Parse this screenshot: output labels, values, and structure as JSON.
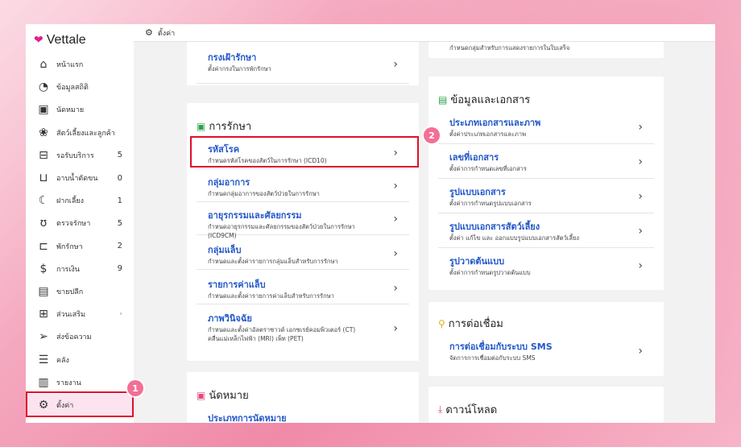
{
  "app": {
    "name": "Vettale"
  },
  "topbar": {
    "title": "ตั้งค่า"
  },
  "sidebar": {
    "items": [
      {
        "label": "หน้าแรก",
        "icon": "home-icon",
        "badge": ""
      },
      {
        "label": "ข้อมูลสถิติ",
        "icon": "stats-icon",
        "badge": ""
      },
      {
        "label": "นัดหมาย",
        "icon": "calendar-icon",
        "badge": ""
      },
      {
        "label": "สัตว์เลี้ยงและลูกค้า",
        "icon": "paw-icon",
        "badge": ""
      },
      {
        "label": "รอรับบริการ",
        "icon": "sofa-icon",
        "badge": "5"
      },
      {
        "label": "อาบน้ำตัดขน",
        "icon": "bathtub-icon",
        "badge": "0"
      },
      {
        "label": "ฝากเลี้ยง",
        "icon": "moon-icon",
        "badge": "1"
      },
      {
        "label": "ตรวจรักษา",
        "icon": "stethoscope-icon",
        "badge": "5"
      },
      {
        "label": "พักรักษา",
        "icon": "bed-icon",
        "badge": "2"
      },
      {
        "label": "การเงิน",
        "icon": "money-hand-icon",
        "badge": "9"
      },
      {
        "label": "ขายปลีก",
        "icon": "cash-register-icon",
        "badge": ""
      },
      {
        "label": "ส่วนเสริม",
        "icon": "plus-box-icon",
        "badge": ""
      },
      {
        "label": "ส่งข้อความ",
        "icon": "send-icon",
        "badge": ""
      },
      {
        "label": "คลัง",
        "icon": "inventory-icon",
        "badge": ""
      },
      {
        "label": "รายงาน",
        "icon": "report-chart-icon",
        "badge": ""
      },
      {
        "label": "ตั้งค่า",
        "icon": "gear-icon",
        "badge": ""
      }
    ]
  },
  "left": {
    "top_row": {
      "title": "กรงเฝ้ารักษา",
      "desc": "ตั้งค่ากรงในการพักรักษา"
    },
    "treatment": {
      "title": "การรักษา",
      "rows": [
        {
          "title": "รหัสโรค",
          "desc": "กำหนดรหัสโรคของสัตว์ในการรักษา (ICD10)"
        },
        {
          "title": "กลุ่มอาการ",
          "desc": "กำหนดกลุ่มอาการของสัตว์ป่วยในการรักษา"
        },
        {
          "title": "อายุรกรรมและศัลยกรรม",
          "desc": "กำหนดอายุรกรรมและศัลยกรรมของสัตว์ป่วยในการรักษา (ICD9CM)"
        },
        {
          "title": "กลุ่มแล็บ",
          "desc": "กำหนดและตั้งค่ารายการกลุ่มแล็บสำหรับการรักษา"
        },
        {
          "title": "รายการค่าแล็บ",
          "desc": "กำหนดและตั้งค่ารายการค่าแล็บสำหรับการรักษา"
        },
        {
          "title": "ภาพวินิจฉัย",
          "desc": "กำหนดและตั้งค่าอัลตราซาวด์ เอกซเรย์คอมพิวเตอร์ (CT) คลื่นแม่เหล็กไฟฟ้า (MRI) เพ็ท (PET)"
        }
      ]
    },
    "appointment": {
      "title": "นัดหมาย",
      "rows": [
        {
          "title": "ประเภทการนัดหมาย"
        }
      ]
    }
  },
  "right": {
    "top_desc": "กำหนดกลุ่มสำหรับการแสดงรายการในใบเสร็จ",
    "documents": {
      "title": "ข้อมูลและเอกสาร",
      "rows": [
        {
          "title": "ประเภทเอกสารและภาพ",
          "desc": "ตั้งค่าประเภทเอกสารและภาพ"
        },
        {
          "title": "เลขที่เอกสาร",
          "desc": "ตั้งค่าการกำหนดเลขที่เอกสาร"
        },
        {
          "title": "รูปแบบเอกสาร",
          "desc": "ตั้งค่าการกำหนดรูปแบบเอกสาร"
        },
        {
          "title": "รูปแบบเอกสารสัตว์เลี้ยง",
          "desc": "ตั้งค่า แก้ไข และ ออกแบบรูปแบบเอกสารสัตว์เลี้ยง"
        },
        {
          "title": "รูปวาดต้นแบบ",
          "desc": "ตั้งค่าการกำหนดรูปวาดต้นแบบ"
        }
      ]
    },
    "integrations": {
      "title": "การต่อเชื่อม",
      "rows": [
        {
          "title": "การต่อเชื่อมกับระบบ SMS",
          "desc": "จัดการการเชื่อมต่อกับระบบ SMS"
        }
      ]
    },
    "download": {
      "title": "ดาวน์โหลด"
    }
  },
  "markers": {
    "one": "1",
    "two": "2"
  },
  "colors": {
    "accent": "#e0218a",
    "link": "#2358c9",
    "highlight": "#e0102a",
    "marker": "#f36f95"
  }
}
